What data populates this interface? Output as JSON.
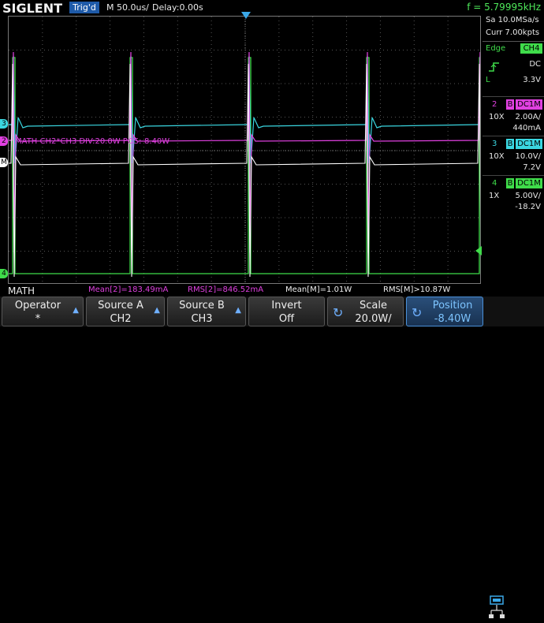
{
  "header": {
    "logo": "SIGLENT",
    "trigger_status": "Trig'd",
    "timebase": "M 50.0us/",
    "delay": "Delay:0.00s",
    "frequency": "f = 5.79995kHz"
  },
  "acquisition": {
    "sample_rate": "Sa 10.0MSa/s",
    "memory": "Curr 7.00kpts"
  },
  "trigger": {
    "type": "Edge",
    "source": "CH4",
    "slope_icon": "rising-edge-icon",
    "coupling": "DC",
    "level_label": "L",
    "level": "3.3V"
  },
  "channels": [
    {
      "num": "2",
      "b": "B",
      "coupling": "DC1M",
      "probe": "10X",
      "scale": "2.00A/",
      "offset": "440mA",
      "color": "#e040e0"
    },
    {
      "num": "3",
      "b": "B",
      "coupling": "DC1M",
      "probe": "10X",
      "scale": "10.0V/",
      "offset": "7.2V",
      "color": "#3ad6e0"
    },
    {
      "num": "4",
      "b": "B",
      "coupling": "DC1M",
      "probe": "1X",
      "scale": "5.00V/",
      "offset": "-18.2V",
      "color": "#3fdc4a"
    }
  ],
  "math_label": "MATH  CH2*CH3  DIV:20.0W  POS:-8.40W",
  "channel_markers": {
    "ch2": "2",
    "ch3": "3",
    "math": "M",
    "ch4": "4"
  },
  "status": {
    "title": "MATH",
    "mean2": "Mean[2]=183.49mA",
    "rms2": "RMS[2]=846.52mA",
    "meanM": "Mean[M]=1.01W",
    "rmsM": "RMS[M]>10.87W"
  },
  "menu": [
    {
      "label": "Operator",
      "value": "*"
    },
    {
      "label": "Source A",
      "value": "CH2"
    },
    {
      "label": "Source B",
      "value": "CH3"
    },
    {
      "label": "Invert",
      "value": "Off"
    },
    {
      "label": "Scale",
      "value": "20.0W/"
    },
    {
      "label": "Position",
      "value": "-8.40W"
    }
  ],
  "colors": {
    "ch2": "#e040e0",
    "ch3": "#3ad6e0",
    "ch4": "#3fdc4a",
    "math": "#ffffff",
    "accent": "#1e5aa8"
  }
}
